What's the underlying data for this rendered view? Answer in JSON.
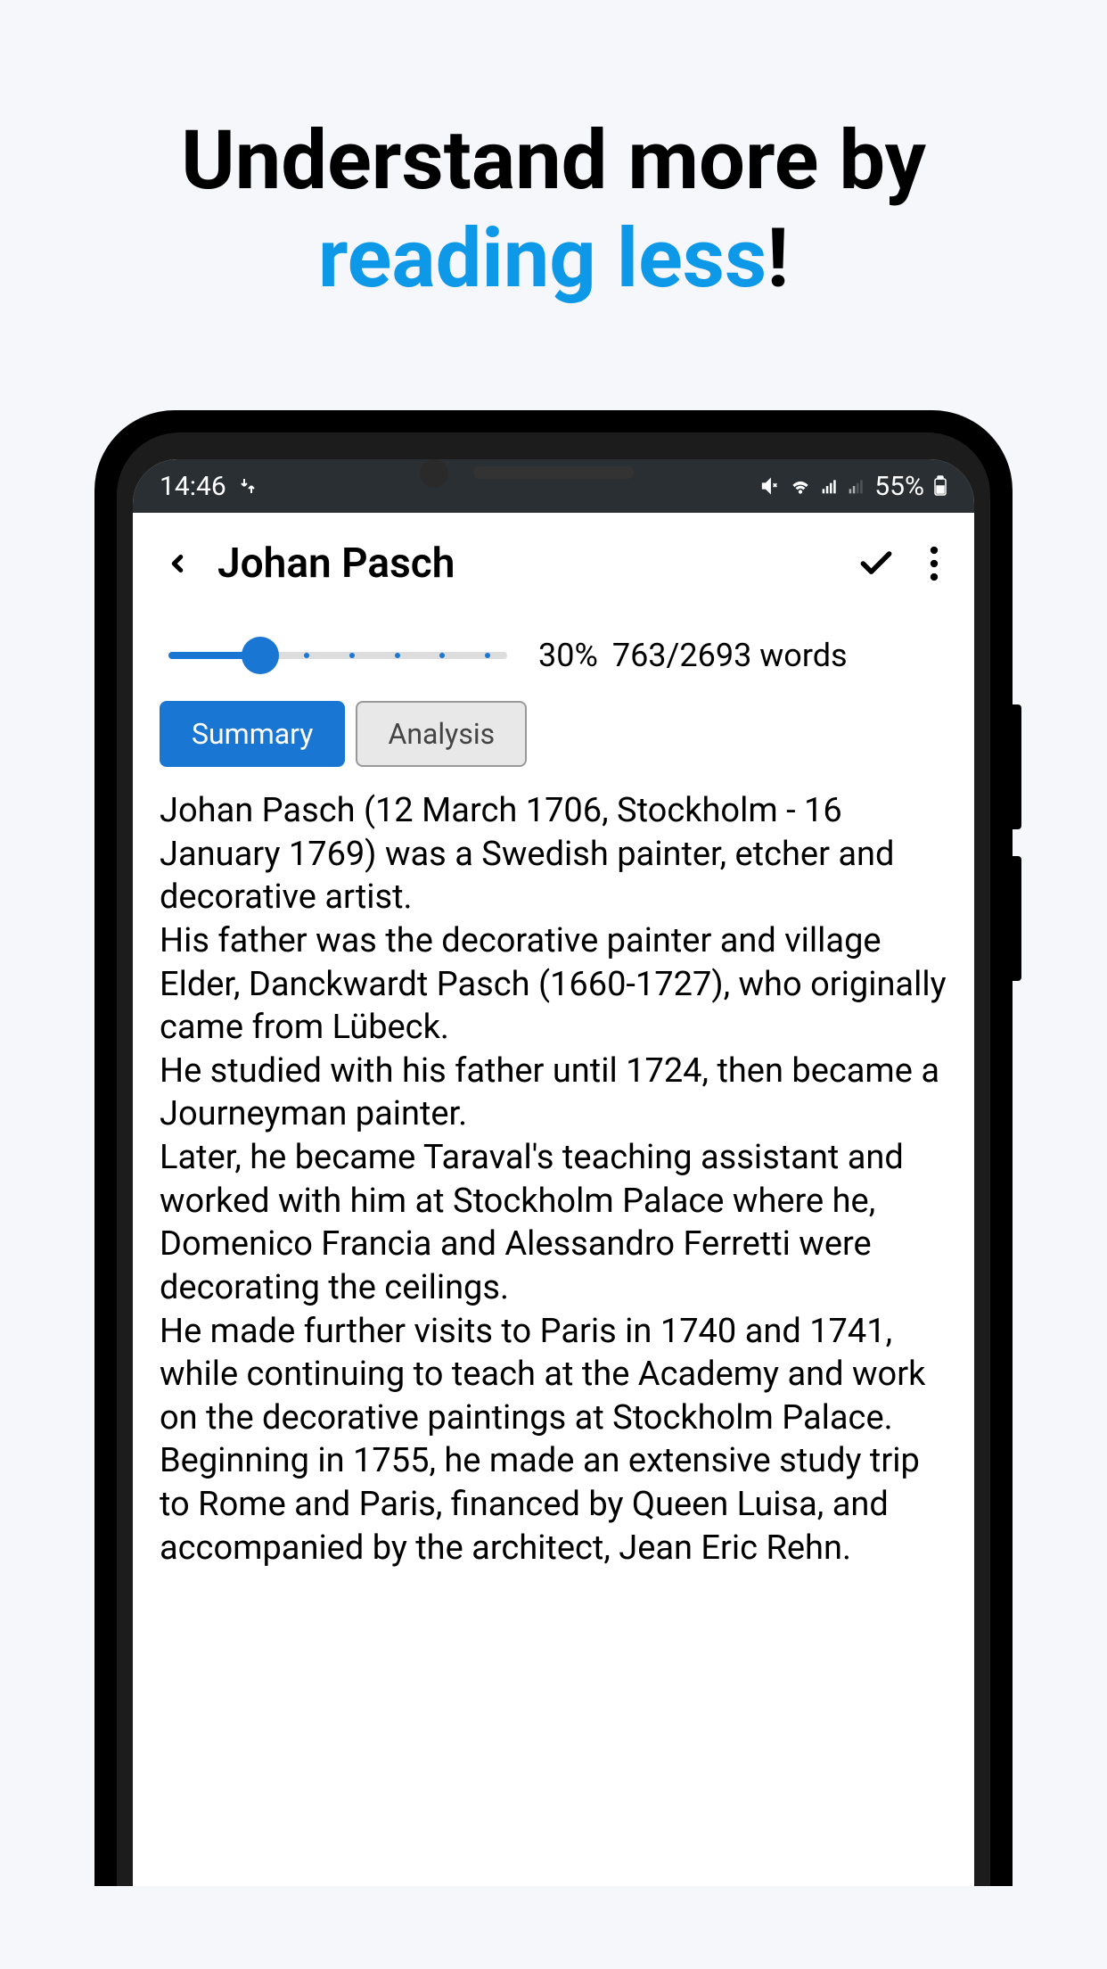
{
  "tagline": {
    "line1": "Understand more by",
    "line2": "reading less",
    "exclaim": "!"
  },
  "statusBar": {
    "time": "14:46",
    "battery": "55%"
  },
  "header": {
    "title": "Johan Pasch"
  },
  "slider": {
    "percent": "30%",
    "wordCount": "763/2693 words"
  },
  "tabs": {
    "summary": "Summary",
    "analysis": "Analysis"
  },
  "content": {
    "p1": "Johan Pasch (12 March 1706, Stockholm - 16 January 1769) was a Swedish painter, etcher and decorative artist.",
    "p2": "His father was the decorative painter and village Elder, Danckwardt Pasch (1660-1727), who originally came from Lübeck.",
    "p3": "He studied with his father until 1724, then became a Journeyman painter.",
    "p4": "Later, he became Taraval's teaching assistant and worked with him at Stockholm Palace where he, Domenico Francia and Alessandro Ferretti were decorating the ceilings.",
    "p5": "He made further visits to Paris in 1740 and 1741, while continuing to teach at the Academy and work on the decorative paintings at Stockholm Palace.",
    "p6": "Beginning in 1755, he made an extensive study trip to Rome and Paris, financed by Queen Luisa, and accompanied by the architect, Jean Eric Rehn."
  }
}
